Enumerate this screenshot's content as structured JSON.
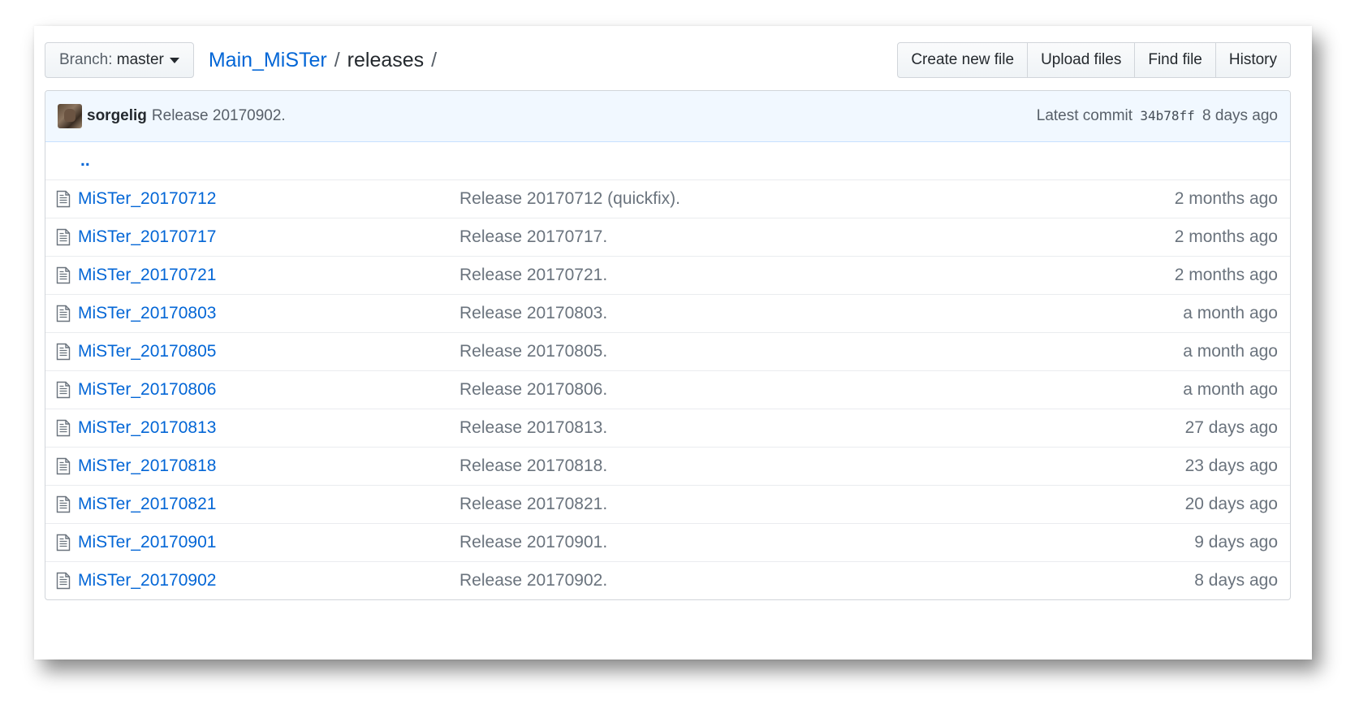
{
  "branch": {
    "label": "Branch:",
    "value": "master"
  },
  "breadcrumb": {
    "repo": "Main_MiSTer",
    "separator": "/",
    "dir": "releases",
    "trailing": "/"
  },
  "actions": [
    "Create new file",
    "Upload files",
    "Find file",
    "History"
  ],
  "commit": {
    "author": "sorgelig",
    "message": "Release 20170902.",
    "latest_label": "Latest commit",
    "sha": "34b78ff",
    "age": "8 days ago"
  },
  "parent_link": "..",
  "files": [
    {
      "name": "MiSTer_20170712",
      "message": "Release 20170712 (quickfix).",
      "age": "2 months ago"
    },
    {
      "name": "MiSTer_20170717",
      "message": "Release 20170717.",
      "age": "2 months ago"
    },
    {
      "name": "MiSTer_20170721",
      "message": "Release 20170721.",
      "age": "2 months ago"
    },
    {
      "name": "MiSTer_20170803",
      "message": "Release 20170803.",
      "age": "a month ago"
    },
    {
      "name": "MiSTer_20170805",
      "message": "Release 20170805.",
      "age": "a month ago"
    },
    {
      "name": "MiSTer_20170806",
      "message": "Release 20170806.",
      "age": "a month ago"
    },
    {
      "name": "MiSTer_20170813",
      "message": "Release 20170813.",
      "age": "27 days ago"
    },
    {
      "name": "MiSTer_20170818",
      "message": "Release 20170818.",
      "age": "23 days ago"
    },
    {
      "name": "MiSTer_20170821",
      "message": "Release 20170821.",
      "age": "20 days ago"
    },
    {
      "name": "MiSTer_20170901",
      "message": "Release 20170901.",
      "age": "9 days ago"
    },
    {
      "name": "MiSTer_20170902",
      "message": "Release 20170902.",
      "age": "8 days ago"
    }
  ],
  "icons": {
    "file": "file-icon",
    "avatar": "avatar"
  },
  "colors": {
    "link": "#0366d6",
    "commit_bg": "#f1f8ff",
    "border": "#d1d5da"
  }
}
